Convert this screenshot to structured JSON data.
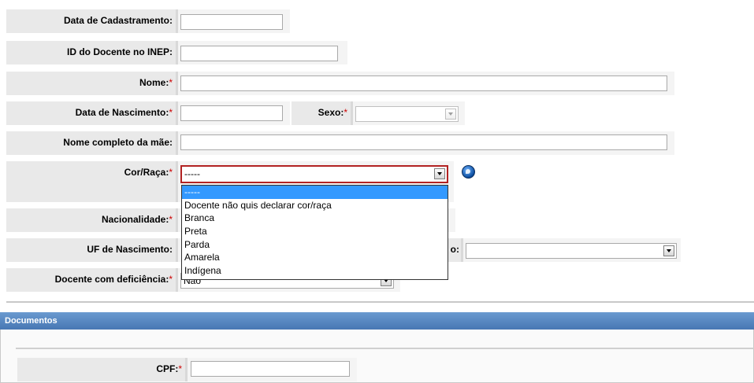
{
  "form": {
    "fields": {
      "data_cadastramento": {
        "label": "Data de Cadastramento:",
        "value": ""
      },
      "id_inep": {
        "label": "ID do Docente no INEP:",
        "value": ""
      },
      "nome": {
        "label": "Nome:",
        "required": "*",
        "value": ""
      },
      "data_nascimento": {
        "label": "Data de Nascimento:",
        "required": "*",
        "value": ""
      },
      "sexo": {
        "label": "Sexo:",
        "required": "*",
        "value": ""
      },
      "nome_mae": {
        "label": "Nome completo da mãe:",
        "value": ""
      },
      "cor_raca": {
        "label": "Cor/Raça:",
        "required": "*",
        "value": "-----",
        "options": [
          "-----",
          "Docente não quis declarar cor/raça",
          "Branca",
          "Preta",
          "Parda",
          "Amarela",
          "Indígena"
        ],
        "highlighted": "-----"
      },
      "nacionalidade": {
        "label": "Nacionalidade:",
        "required": "*"
      },
      "uf_nascimento": {
        "label": "UF de Nascimento:",
        "partial_label": "o:",
        "value": ""
      },
      "deficiencia": {
        "label": "Docente com deficiência:",
        "required": "*",
        "value": "Não"
      }
    },
    "help_icon": "help-balloon-icon"
  },
  "documentos": {
    "title": "Documentos",
    "cpf": {
      "label": "CPF:",
      "required": "*",
      "value": ""
    }
  },
  "colors": {
    "label_bg": "#e9e9e9",
    "required": "#cc0000",
    "section_bar": "#4f7fbc",
    "dropdown_highlight": "#3399ff",
    "active_border": "#b22222"
  }
}
